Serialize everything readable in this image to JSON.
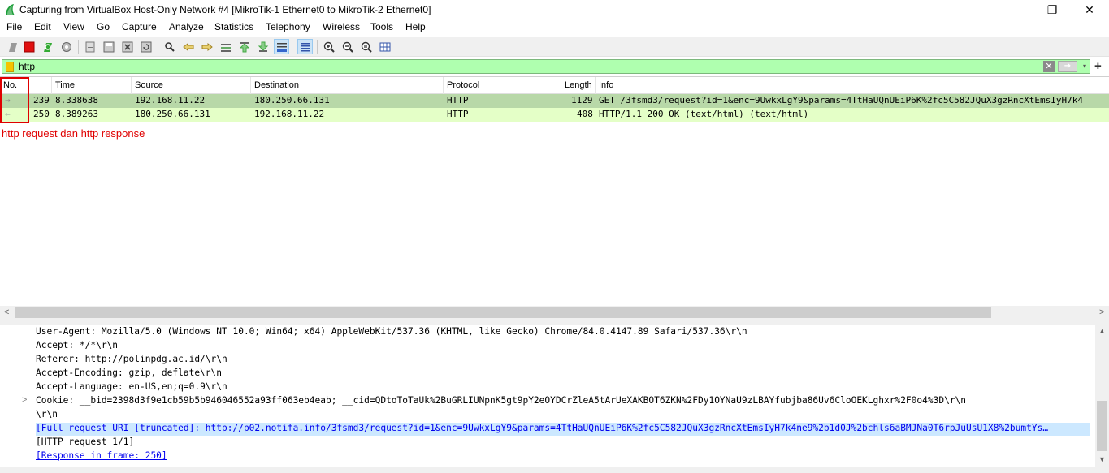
{
  "window": {
    "title": "Capturing from VirtualBox Host-Only Network #4 [MikroTik-1 Ethernet0 to MikroTik-2 Ethernet0]",
    "minimize": "—",
    "restore": "❐",
    "close": "✕"
  },
  "menu": {
    "items": [
      "File",
      "Edit",
      "View",
      "Go",
      "Capture",
      "Analyze",
      "Statistics",
      "Telephony",
      "Wireless",
      "Tools",
      "Help"
    ]
  },
  "filter": {
    "value": "http",
    "bg_color": "#afffaf",
    "clear_icon": "✕",
    "apply_icon": "➔",
    "dropdown_icon": "▾",
    "add_icon": "+"
  },
  "columns": [
    "No.",
    "Time",
    "Source",
    "Destination",
    "Protocol",
    "Length",
    "Info"
  ],
  "packets": [
    {
      "no": "239",
      "time": "8.338638",
      "source": "192.168.11.22",
      "destination": "180.250.66.131",
      "protocol": "HTTP",
      "length": "1129",
      "info": "GET /3fsmd3/request?id=1&enc=9UwkxLgY9&params=4TtHaUQnUEiP6K%2fc5C582JQuX3gzRncXtEmsIyH7k4",
      "direction": "→",
      "row_color": "#b8d8a8"
    },
    {
      "no": "250",
      "time": "8.389263",
      "source": "180.250.66.131",
      "destination": "192.168.11.22",
      "protocol": "HTTP",
      "length": "408",
      "info": "HTTP/1.1 200 OK  (text/html) (text/html)",
      "direction": "←",
      "row_color": "#e4ffc7"
    }
  ],
  "annotation": "http request dan http response",
  "details": [
    {
      "text": "User-Agent: Mozilla/5.0 (Windows NT 10.0; Win64; x64) AppleWebKit/537.36 (KHTML, like Gecko) Chrome/84.0.4147.89 Safari/537.36\\r\\n",
      "type": "text"
    },
    {
      "text": "Accept: */*\\r\\n",
      "type": "text"
    },
    {
      "text": "Referer: http://polinpdg.ac.id/\\r\\n",
      "type": "text"
    },
    {
      "text": "Accept-Encoding: gzip, deflate\\r\\n",
      "type": "text"
    },
    {
      "text": "Accept-Language: en-US,en;q=0.9\\r\\n",
      "type": "text"
    },
    {
      "text": "Cookie: __bid=2398d3f9e1cb59b5b946046552a93ff063eb4eab; __cid=QDtoToTaUk%2BuGRLIUNpnK5gt9pY2eOYDCrZleA5tArUeXAKBOT6ZKN%2FDy1OYNaU9zLBAYfubjba86Uv6CloOEKLghxr%2F0o4%3D\\r\\n",
      "type": "expandable"
    },
    {
      "text": "\\r\\n",
      "type": "text"
    },
    {
      "text": "[Full request URI [truncated]: http://p02.notifa.info/3fsmd3/request?id=1&enc=9UwkxLgY9&params=4TtHaUQnUEiP6K%2fc5C582JQuX3gzRncXtEmsIyH7k4ne9%2b1d0J%2bchls6aBMJNa0T6rpJuUsU1X8%2bumtYs…",
      "type": "link-selected"
    },
    {
      "text": "[HTTP request 1/1]",
      "type": "text"
    },
    {
      "text": "[Response in frame: 250]",
      "type": "link"
    }
  ]
}
